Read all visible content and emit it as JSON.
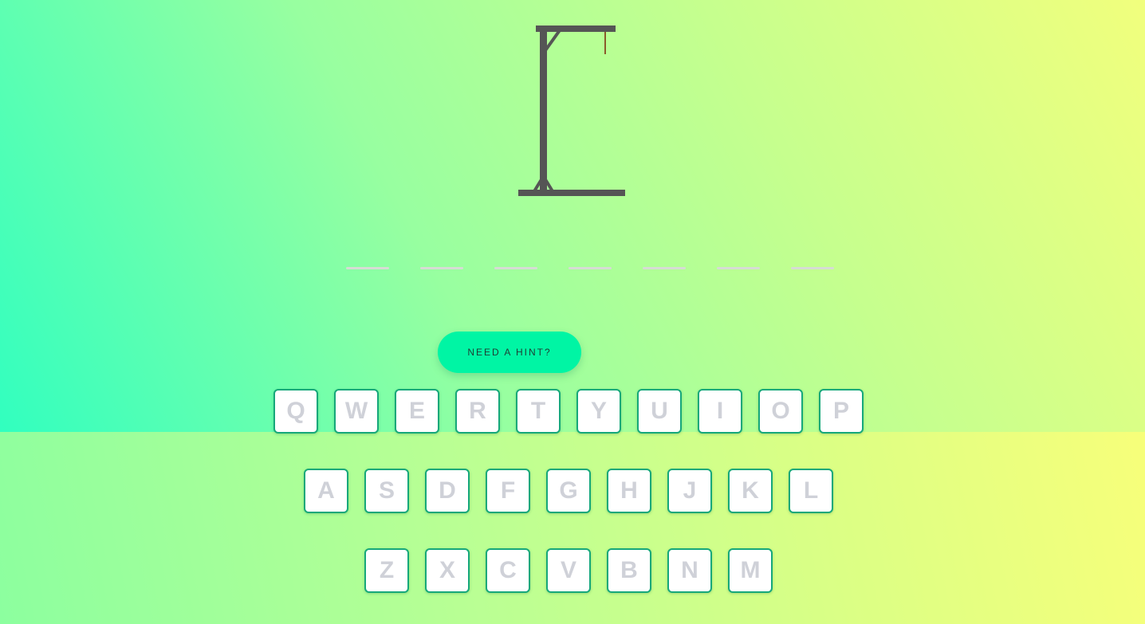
{
  "game": {
    "word_length": 7,
    "hint_button_label": "NEED A HINT?"
  },
  "keyboard": {
    "rows": [
      [
        "Q",
        "W",
        "E",
        "R",
        "T",
        "Y",
        "U",
        "I",
        "O",
        "P"
      ],
      [
        "A",
        "S",
        "D",
        "F",
        "G",
        "H",
        "J",
        "K",
        "L"
      ],
      [
        "Z",
        "X",
        "C",
        "V",
        "B",
        "N",
        "M"
      ]
    ]
  },
  "colors": {
    "gallows": "#555555",
    "rope": "#8a5a2b",
    "hint_button": "#00f5a4",
    "key_border": "#16a87a",
    "key_text": "#cfd1d8",
    "word_slot": "#d6dcd4"
  }
}
